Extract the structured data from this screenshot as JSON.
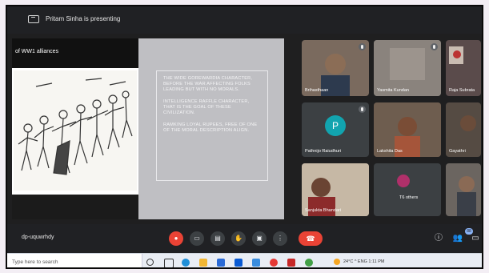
{
  "topbar": {
    "presenting_text": "Pritam Sinha is presenting"
  },
  "slide": {
    "title": "of WW1 alliances",
    "bullets": [
      "THE WIDE GOREWARDIA CHARACTER, BEFORE THE WAR AFFECTING FOLKS LEADING BUT WITH NO MORALS.",
      "INTELLIGENCE RAFFLE CHARACTER, THAT IS THE GOAL OF THESE CIVILIZATION.",
      "RAMKING LOYAL RUPEES, FREE OF ONE OF THE MORAL DESCRIPTION ALIGN."
    ]
  },
  "participants": [
    {
      "name": "Brihasthaan",
      "type": "video",
      "color": "#6b5a4e"
    },
    {
      "name": "Yasmita Kundan",
      "type": "video",
      "color": "#6f6a66"
    },
    {
      "name": "Raja Subrata",
      "type": "video",
      "color": "#5a4b4b"
    },
    {
      "name": "Pathnijo Raiudhuri",
      "type": "avatar",
      "letter": "P",
      "avatar_color": "#12a4af"
    },
    {
      "name": "Lakshita Das",
      "type": "video",
      "color": "#5c4a3c"
    },
    {
      "name": "Gayathri",
      "type": "video",
      "color": "#554b43"
    },
    {
      "name": "Sanjukta Bhandari",
      "type": "video",
      "color": "#a09484"
    },
    {
      "name": "T6 others",
      "type": "stack",
      "avatar_color": "#b0306a"
    },
    {
      "name": "",
      "type": "video",
      "color": "#6b6560"
    }
  ],
  "bottombar": {
    "meeting_code": "dp-uquwrhdy",
    "participant_count": "88",
    "controls": [
      "mic-off",
      "camera",
      "captions",
      "raise-hand",
      "present",
      "more"
    ]
  },
  "taskbar": {
    "search_placeholder": "Type here to search",
    "tray_text": "24°C  ^  ENG  1:11 PM"
  },
  "colors": {
    "end_call": "#ea4335",
    "dark_bg": "#202124",
    "avatar_teal": "#12a4af"
  }
}
